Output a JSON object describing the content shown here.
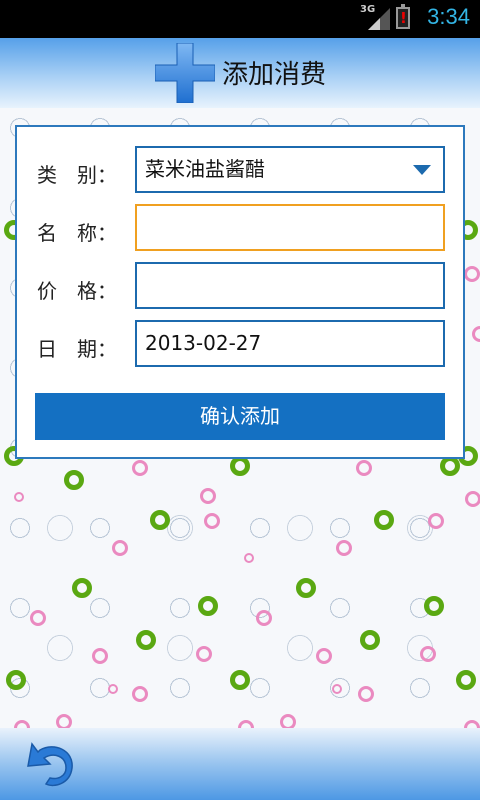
{
  "status_bar": {
    "network": "3G",
    "battery_alert": "!",
    "time": "3:34"
  },
  "header": {
    "title": "添加消费",
    "icon": "plus-icon",
    "accent_color": "#2f7fd8"
  },
  "form": {
    "category": {
      "label": "类　别：",
      "value": "菜米油盐酱醋"
    },
    "name": {
      "label": "名　称：",
      "value": ""
    },
    "price": {
      "label": "价　格：",
      "value": ""
    },
    "date": {
      "label": "日　期：",
      "value": "2013-02-27"
    },
    "confirm_label": "确认添加",
    "button_color": "#1470c2"
  },
  "bottom_bar": {
    "back_icon": "undo-arrow-icon"
  }
}
